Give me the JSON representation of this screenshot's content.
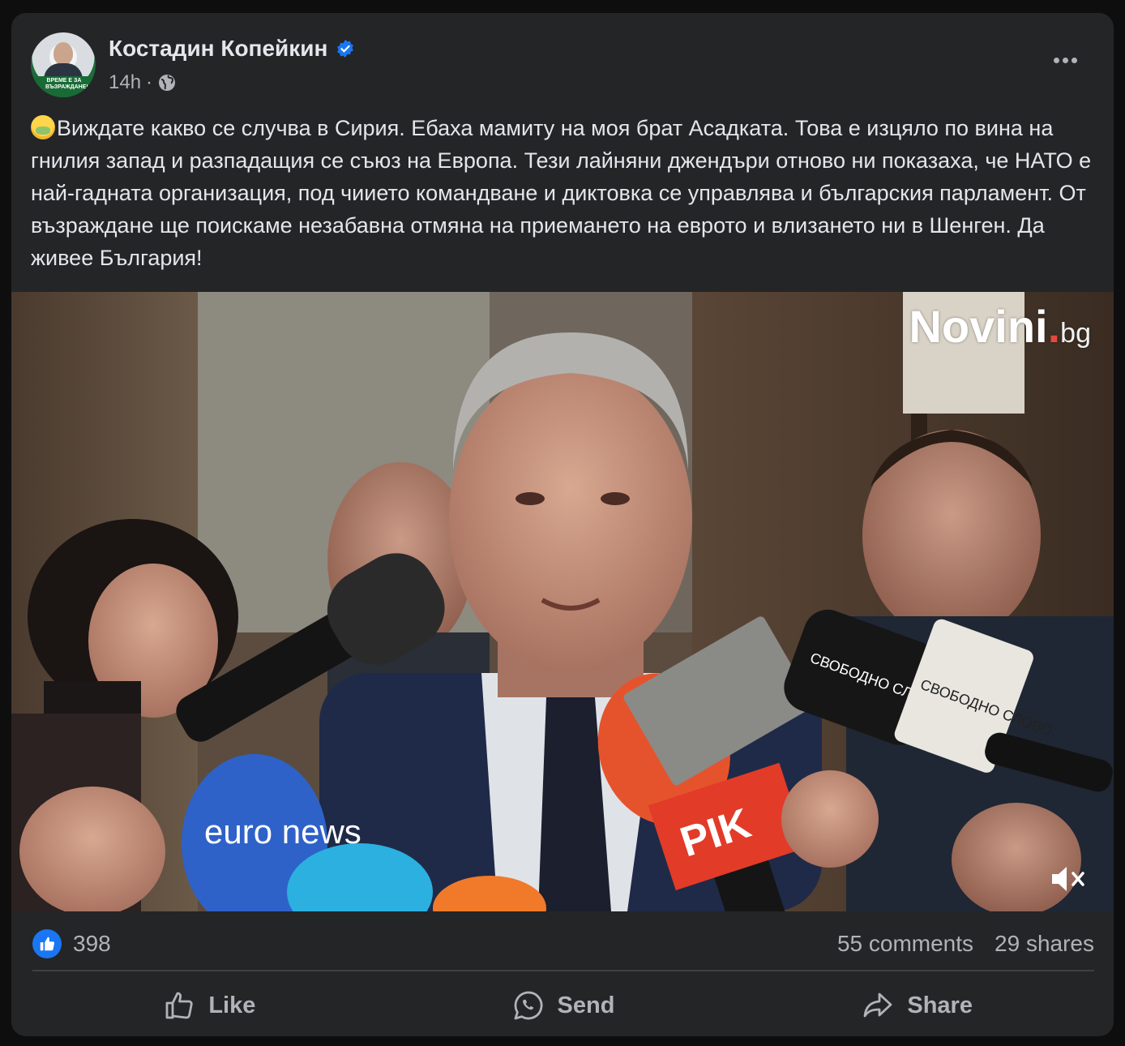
{
  "post": {
    "author": {
      "name": "Костадин Копейкин",
      "verified": true,
      "avatar_band_text": "ВРЕМЕ Е ЗА ВЪЗРАЖДАНЕ!"
    },
    "time": "14h",
    "separator": "·",
    "audience_icon": "globe-icon",
    "more_icon": "more-options-icon",
    "emoji": "nauseated-face-emoji",
    "text": "Виждате какво се случва в Сирия. Ебаха мамиту на моя брат Асадката. Това е изцяло по вина на гнилия запад и разпадащия се съюз на Европа. Тези лайняни джендъри отново ни показаха, че НАТО е най-гадната организация, под чиието командване и диктовка се управлява и българския парламент. От възраждане ще поискаме незабавна отмяна на приемането на еврото и влизането ни в Шенген. Да живее България!",
    "media": {
      "watermark_main": "Novini",
      "watermark_dot": ".",
      "watermark_suffix": "bg",
      "mic_labels": [
        "euro news",
        "PIK",
        "СВОБОДНО СЛОВО",
        "СВОБОДНО СЛОВО"
      ],
      "mute_icon": "speaker-muted-icon"
    },
    "stats": {
      "reactions": "398",
      "comments": "55 comments",
      "shares": "29 shares"
    },
    "actions": {
      "like": "Like",
      "send": "Send",
      "share": "Share"
    }
  },
  "colors": {
    "card_bg": "#242526",
    "text_primary": "#e4e6eb",
    "text_secondary": "#b0b3b8",
    "like_blue": "#1a76f2",
    "verified_blue": "#1a76f2"
  }
}
